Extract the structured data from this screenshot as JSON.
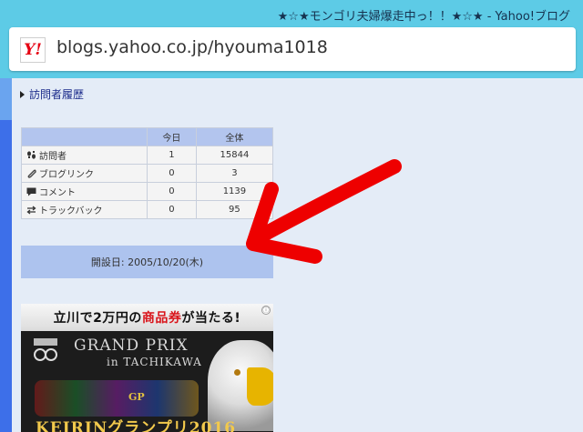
{
  "browser": {
    "tab_title": "★☆★モンゴリ夫婦爆走中っ！！★☆★ - Yahoo!ブログ",
    "favicon_text": "Y!",
    "url": "blogs.yahoo.co.jp/hyouma1018"
  },
  "sidebar": {
    "section_title": "訪問者履歴",
    "stats": {
      "headers": [
        "",
        "今日",
        "全体"
      ],
      "rows": [
        {
          "icon": "footprints-icon",
          "label": "訪問者",
          "today": "1",
          "total": "15844"
        },
        {
          "icon": "paperclip-icon",
          "label": "ブログリンク",
          "today": "0",
          "total": "3"
        },
        {
          "icon": "comment-icon",
          "label": "コメント",
          "today": "0",
          "total": "1139"
        },
        {
          "icon": "trackback-icon",
          "label": "トラックバック",
          "today": "0",
          "total": "95"
        }
      ]
    },
    "established": "開設日: 2005/10/20(木)"
  },
  "ad": {
    "headline_pre": "立川で2万円の",
    "headline_emph": "商品券",
    "headline_post": "が当たる!",
    "title": "GRAND PRIX",
    "subtitle": "in TACHIKAWA",
    "gp_mark": "GP",
    "event": "KEIRINグランプリ2016",
    "close_glyph": "ⓘ"
  },
  "colors": {
    "chrome": "#5dcbe6",
    "page_bg": "#e4ecf7",
    "side_strip": "#3d6fe9",
    "table_header": "#b3c5ee",
    "annotation_arrow": "#ee0000"
  }
}
